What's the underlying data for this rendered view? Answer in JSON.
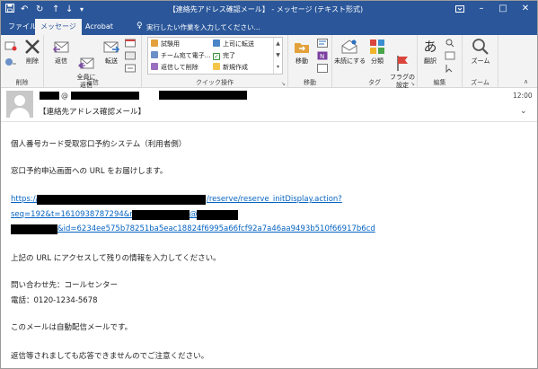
{
  "titlebar": {
    "title": "【連絡先アドレス確認メール】 - メッセージ (テキスト形式)",
    "quick_icons": [
      "save-icon",
      "undo-icon",
      "redo-icon",
      "up-icon",
      "down-icon",
      "customize-icon"
    ],
    "window_controls": [
      "restore-ribbon-icon",
      "minimize-icon",
      "maximize-icon",
      "close-icon"
    ]
  },
  "tabs": [
    {
      "label": "ファイル",
      "active": false
    },
    {
      "label": "メッセージ",
      "active": true
    },
    {
      "label": "Acrobat",
      "active": false
    }
  ],
  "tell_me": "実行したい作業を入力してください...",
  "ribbon": {
    "delete_group": {
      "label": "削除",
      "delete_button": "削除"
    },
    "respond_group": {
      "label": "返信",
      "reply": "返信",
      "reply_all": "全員に\n返信",
      "forward": "転送"
    },
    "quick_steps_group": {
      "label": "クイック操作",
      "items": [
        "試験用",
        "チーム宛て電子...",
        "返信して削除",
        "上司に転送",
        "完了",
        "新規作成"
      ]
    },
    "move_group": {
      "label": "移動",
      "move": "移動"
    },
    "tags_group": {
      "label": "タグ",
      "unread": "未読にする",
      "categorize": "分類",
      "follow_up": "フラグの\n設定"
    },
    "editing_group": {
      "label": "編集",
      "translate": "翻訳"
    },
    "zoom_group": {
      "label": "ズーム",
      "zoom": "ズーム"
    },
    "colors": {
      "accent": "#2b579a",
      "tab_bg": "#f3f3f3",
      "link": "#0563c1"
    }
  },
  "header": {
    "sender_at": "@",
    "time": "12:00",
    "subject": "【連絡先アドレス確認メール】"
  },
  "body": {
    "line1": "個人番号カード受取窓口予約システム（利用者側）",
    "line2": "窓口予約申込画面への URL をお届けします。",
    "link1_prefix": "https://",
    "link1_suffix": "/reserve/reserve_initDisplay.action?",
    "link2_prefix": "seq=192&t=1610938787294&mail=",
    "link2_at": "@",
    "link3_suffix": "&id=6234ee575b78251ba5eac18824f6995a66fcf92a7a46aa9493b510f66917b6cd",
    "line4": "上記の URL にアクセスして残りの情報を入力してください。",
    "line5": "問い合わせ先：コールセンター",
    "line6": "電話：0120-1234-5678",
    "line7": "このメールは自動配信メールです。",
    "line8": "返信等されましても応答できませんのでご注意ください。"
  }
}
